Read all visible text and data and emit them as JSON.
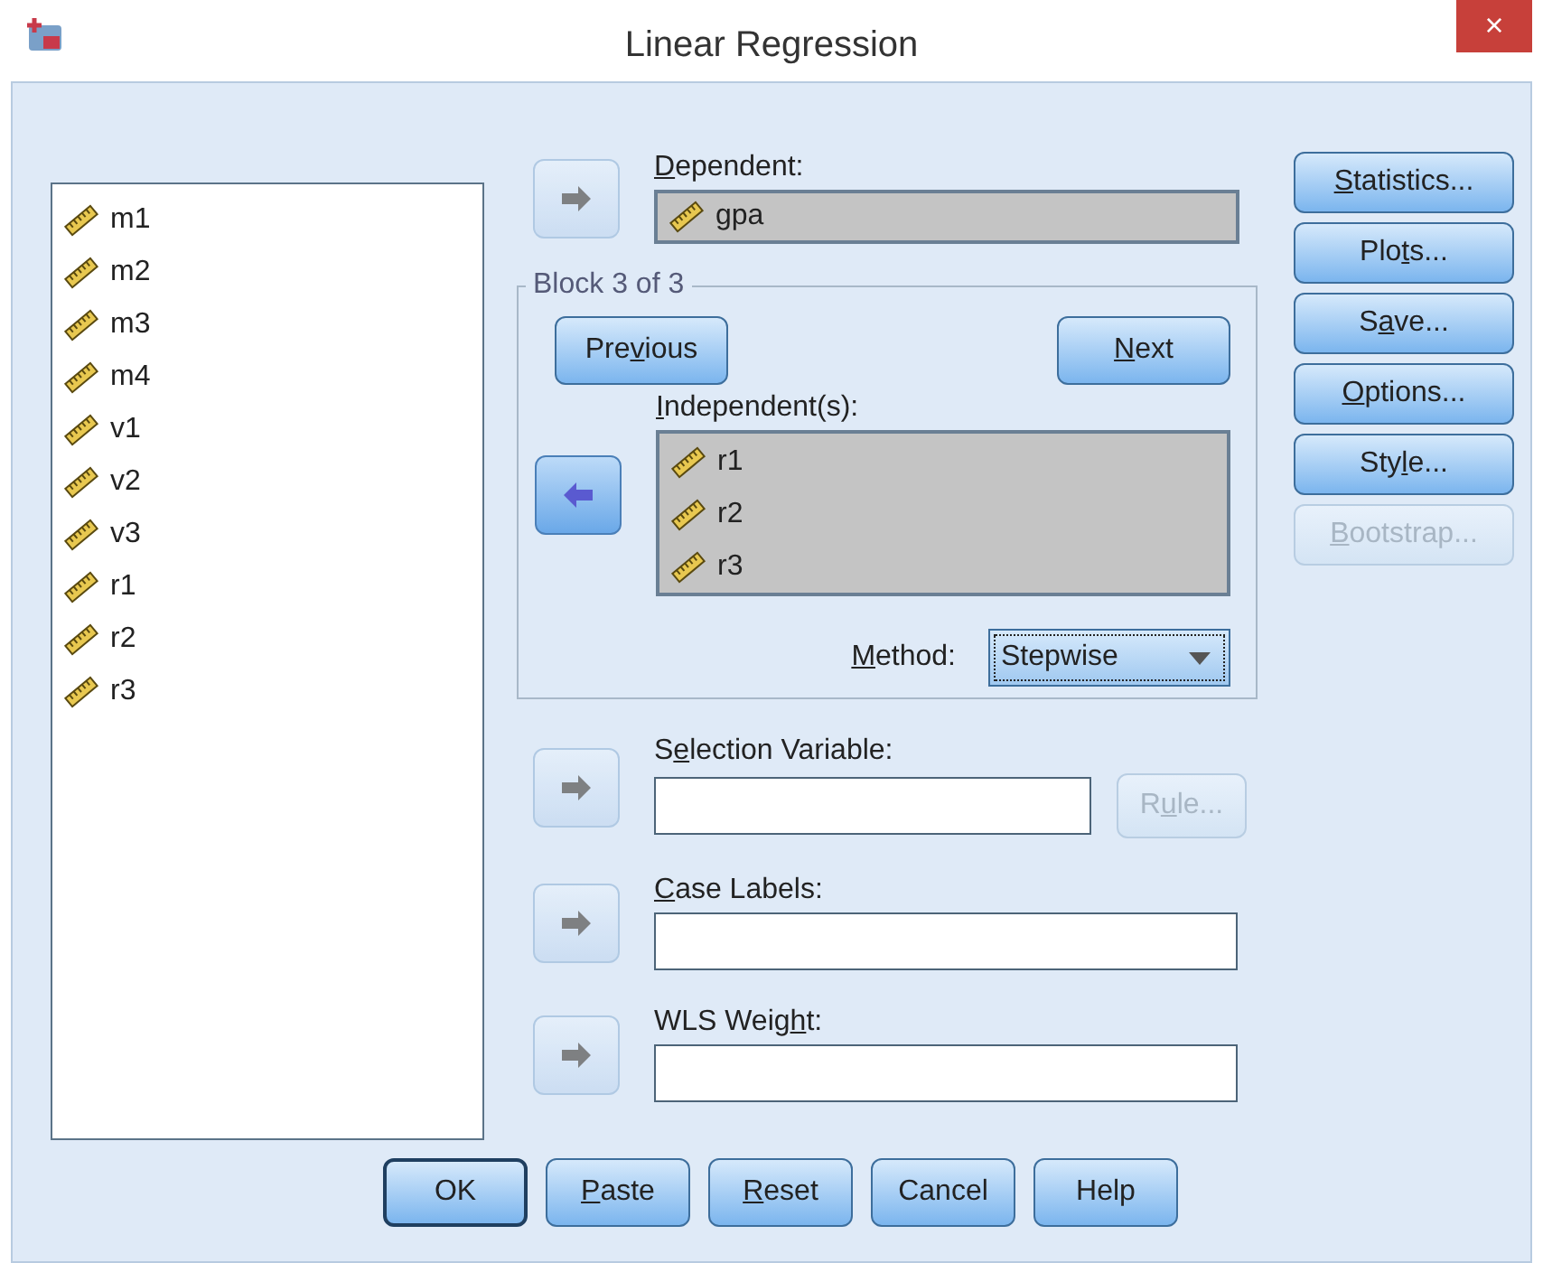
{
  "window": {
    "title": "Linear Regression",
    "close": "×"
  },
  "source_variables": [
    {
      "name": "m1",
      "selected": false
    },
    {
      "name": "m2",
      "selected": false
    },
    {
      "name": "m3",
      "selected": false
    },
    {
      "name": "m4",
      "selected": false
    },
    {
      "name": "v1",
      "selected": false
    },
    {
      "name": "v2",
      "selected": false
    },
    {
      "name": "v3",
      "selected": false
    },
    {
      "name": "r1",
      "selected": false
    },
    {
      "name": "r2",
      "selected": false
    },
    {
      "name": "r3",
      "selected": false
    }
  ],
  "dependent": {
    "label": {
      "key": "D",
      "after": "ependent:"
    },
    "arrow": {
      "kind": "right",
      "disabled": true
    },
    "variables": [
      "gpa"
    ]
  },
  "block": {
    "title": "Block 3 of 3",
    "previous": {
      "before": "Pre",
      "key": "v",
      "after": "ious",
      "disabled": false
    },
    "next": {
      "key": "N",
      "after": "ext",
      "disabled": false
    },
    "independents": {
      "label": {
        "key": "I",
        "after": "ndependent(s):"
      },
      "arrow": {
        "kind": "left",
        "disabled": false
      },
      "variables": [
        "r1",
        "r2",
        "r3"
      ]
    },
    "method": {
      "label": {
        "key": "M",
        "after": "ethod:"
      },
      "value": "Stepwise"
    }
  },
  "fields": [
    {
      "label": {
        "before": "S",
        "key": "e",
        "after": "lection Variable:"
      },
      "arrow": {
        "kind": "right",
        "disabled": true
      },
      "rule": {
        "before": "R",
        "key": "u",
        "after": "le...",
        "disabled": true
      }
    },
    {
      "label": {
        "key": "C",
        "after": "ase Labels:"
      },
      "arrow": {
        "kind": "right",
        "disabled": true
      }
    },
    {
      "label": {
        "before": "WLS Weig",
        "key": "h",
        "after": "t:"
      },
      "arrow": {
        "kind": "right",
        "disabled": true
      }
    }
  ],
  "side_buttons": [
    {
      "key": "S",
      "after": "tatistics...",
      "disabled": false
    },
    {
      "before": "Plo",
      "key": "t",
      "after": "s...",
      "disabled": false
    },
    {
      "before": "S",
      "key": "a",
      "after": "ve...",
      "disabled": false
    },
    {
      "key": "O",
      "after": "ptions...",
      "disabled": false
    },
    {
      "before": "Sty",
      "key": "l",
      "after": "e...",
      "disabled": false
    },
    {
      "key": "B",
      "after": "ootstrap...",
      "disabled": true
    }
  ],
  "bottom_buttons": [
    {
      "before": "OK",
      "default": true
    },
    {
      "key": "P",
      "after": "aste",
      "default": false
    },
    {
      "key": "R",
      "after": "eset",
      "default": false
    },
    {
      "before": "Cancel",
      "default": false
    },
    {
      "before": "Help",
      "default": false
    }
  ]
}
